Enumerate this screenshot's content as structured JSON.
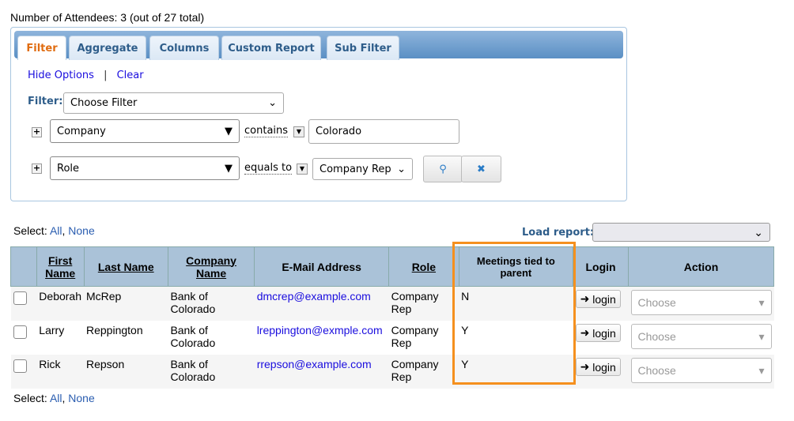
{
  "header": {
    "attendees": "Number of Attendees: 3 (out of 27 total)"
  },
  "tabs": [
    "Filter",
    "Aggregate",
    "Columns",
    "Custom Report",
    "Sub Filter"
  ],
  "options": {
    "hide": "Hide Options",
    "sep": "|",
    "clear": "Clear"
  },
  "filter": {
    "label": "Filter:",
    "choose": "Choose Filter",
    "rows": [
      {
        "field": "Company",
        "op": "contains",
        "value": "Colorado"
      },
      {
        "field": "Role",
        "op": "equals to",
        "value": "Company Rep"
      }
    ]
  },
  "select": {
    "label": "Select:",
    "all": "All",
    "comma": ",",
    "none": "None"
  },
  "load_report": "Load report:",
  "table": {
    "headers": [
      "First Name",
      "Last Name",
      "Company Name",
      "E-Mail Address",
      "Role",
      "Meetings tied to parent",
      "Login",
      "Action"
    ],
    "rows": [
      {
        "first": "Deborah",
        "last": "McRep",
        "company": "Bank of Colorado",
        "email": "dmcrep@example.com",
        "role": "Company Rep",
        "meetings": "N",
        "login": "login",
        "action": "Choose"
      },
      {
        "first": "Larry",
        "last": "Reppington",
        "company": "Bank of Colorado",
        "email": "lreppington@exmple.com",
        "role": "Company Rep",
        "meetings": "Y",
        "login": "login",
        "action": "Choose"
      },
      {
        "first": "Rick",
        "last": "Repson",
        "company": "Bank of Colorado",
        "email": "rrepson@example.com",
        "role": "Company Rep",
        "meetings": "Y",
        "login": "login",
        "action": "Choose"
      }
    ]
  },
  "highlight_color": "#f5901e"
}
